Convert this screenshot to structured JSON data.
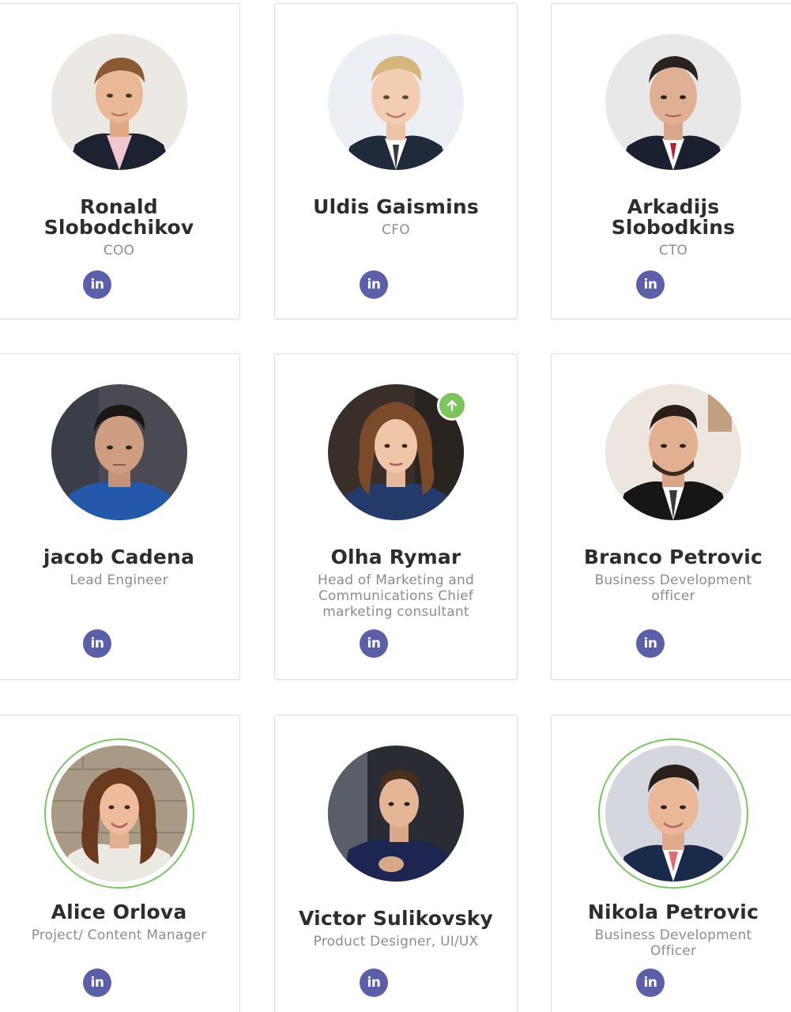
{
  "team": [
    {
      "name": "Ronald Slobodchikov",
      "role": "COO",
      "social": "linkedin-icon",
      "name_lines": [
        "Ronald",
        "Slobodchikov"
      ]
    },
    {
      "name": "Uldis Gaismins",
      "role": "CFO",
      "social": "linkedin-icon"
    },
    {
      "name": "Arkadijs Slobodkins",
      "role": "CTO",
      "social": "linkedin-icon",
      "name_lines": [
        "Arkadijs",
        "Slobodkins"
      ]
    },
    {
      "name": "jacob Cadena",
      "role": "Lead Engineer",
      "social": "linkedin-icon"
    },
    {
      "name": "Olha Rymar",
      "role": "Head of Marketing and Communications Chief marketing consultant",
      "role_lines": [
        "Head of Marketing and",
        "Communications Chief",
        "marketing consultant"
      ],
      "social": "linkedin-icon",
      "badge": "arrow-up-icon"
    },
    {
      "name": "Branco Petrovic",
      "role": "Business Development officer",
      "role_lines": [
        "Business Development",
        "officer"
      ],
      "social": "linkedin-icon"
    },
    {
      "name": "Alice Orlova",
      "role": "Project/ Content Manager",
      "social": "linkedin-icon",
      "ring": true
    },
    {
      "name": "Victor Sulikovsky",
      "role": "Product Designer, UI/UX",
      "social": "linkedin-icon"
    },
    {
      "name": "Nikola Petrovic",
      "role": "Business Development Officer",
      "role_lines": [
        "Business Development",
        "Officer"
      ],
      "social": "linkedin-icon",
      "ring": true
    }
  ],
  "linkedin_label": "in",
  "colors": {
    "linkedin": "#5b5fa8",
    "ring": "#79c463",
    "badge": "#7cc45c",
    "name": "#2d2d2d",
    "role": "#8c8c8c"
  }
}
